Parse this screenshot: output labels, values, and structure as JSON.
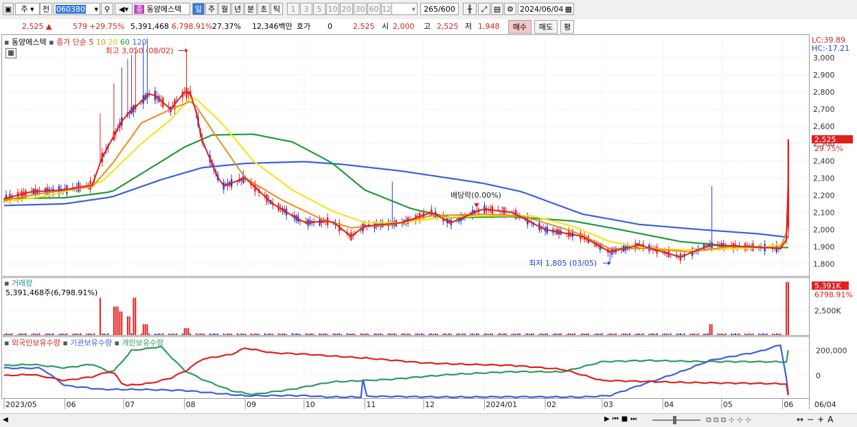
{
  "toolbar": {
    "tab_stock": "주",
    "tab_prev": "전",
    "code": "060380",
    "stock_badge": "종",
    "stock_name": "동양에스텍",
    "periods": [
      "일",
      "주",
      "월",
      "년",
      "분",
      "초",
      "틱"
    ],
    "selected_period": "일",
    "intervals": [
      "1",
      "3",
      "5",
      "10",
      "20",
      "30",
      "60",
      "120"
    ],
    "count": "265",
    "count_total": "/600",
    "date": "2024/06/04"
  },
  "quote": {
    "price": "2,525",
    "change": "579",
    "change_pct": "+29.75%",
    "volume": "5,391,468",
    "volume_pct": "6,798.91%",
    "turnover_pct": "27.37%",
    "amount": "12,346백만",
    "ask_label": "호가",
    "ask_value": "0",
    "ask_price": "2,525",
    "open_label": "시",
    "open": "2,000",
    "high_label": "고",
    "high": "2,525",
    "low_label": "저",
    "low": "1,948",
    "buy_label": "매수",
    "sell_label": "매도",
    "avg_label": "평"
  },
  "colors": {
    "up": "#e0201e",
    "down": "#1f3fd6",
    "ma5": "#e0201e",
    "ma10": "#f08a16",
    "ma20": "#f6e61a",
    "ma60": "#1e9a3a",
    "ma120": "#3a5fe0",
    "foreign": "#e0201e",
    "institution": "#3a5fe0",
    "individual": "#2e9a5e"
  },
  "chart_data": [
    {
      "type": "candlestick",
      "legend_name": "동양에스텍",
      "legend_series": "종가 단순",
      "ma_periods": [
        "5",
        "10",
        "20",
        "60",
        "120"
      ],
      "y_ticks": [
        "3,000",
        "2,900",
        "2,800",
        "2,700",
        "2,600",
        "2,500",
        "2,400",
        "2,300",
        "2,200",
        "2,100",
        "2,000",
        "1,900",
        "1,800"
      ],
      "ylim": [
        1730,
        3120
      ],
      "lc_label": "LC:39.89",
      "hc_label": "HC:-17.21",
      "last_price_label": "2,525",
      "last_change_label": "29.75%",
      "max_annotation": "최고 3,050 (08/02)",
      "min_annotation": "최저 1,805 (03/05)",
      "dividend_annotation": "배당락(0.00%)",
      "ma5_key": [
        [
          "2023-05-01",
          2180
        ],
        [
          "2023-05-15",
          2220
        ],
        [
          "2023-05-31",
          2230
        ],
        [
          "2023-06-15",
          2260
        ],
        [
          "2023-06-20",
          2420
        ],
        [
          "2023-07-01",
          2650
        ],
        [
          "2023-07-15",
          2800
        ],
        [
          "2023-07-25",
          2700
        ],
        [
          "2023-08-01",
          2800
        ],
        [
          "2023-08-05",
          2790
        ],
        [
          "2023-08-10",
          2520
        ],
        [
          "2023-08-20",
          2250
        ],
        [
          "2023-09-01",
          2300
        ],
        [
          "2023-09-15",
          2150
        ],
        [
          "2023-10-01",
          2040
        ],
        [
          "2023-10-15",
          2050
        ],
        [
          "2023-10-25",
          1960
        ],
        [
          "2023-11-01",
          2020
        ],
        [
          "2023-11-20",
          2040
        ],
        [
          "2023-12-05",
          2100
        ],
        [
          "2023-12-15",
          2040
        ],
        [
          "2023-12-31",
          2120
        ],
        [
          "2024-01-15",
          2100
        ],
        [
          "2024-02-01",
          2000
        ],
        [
          "2024-02-20",
          1960
        ],
        [
          "2024-03-05",
          1870
        ],
        [
          "2024-03-20",
          1910
        ],
        [
          "2024-04-10",
          1840
        ],
        [
          "2024-04-25",
          1910
        ],
        [
          "2024-05-15",
          1900
        ],
        [
          "2024-05-31",
          1890
        ],
        [
          "2024-06-03",
          1940
        ],
        [
          "2024-06-04",
          2300
        ]
      ],
      "ma10_key": [
        [
          "2023-05-01",
          2170
        ],
        [
          "2023-05-20",
          2210
        ],
        [
          "2023-06-15",
          2250
        ],
        [
          "2023-06-25",
          2380
        ],
        [
          "2023-07-10",
          2620
        ],
        [
          "2023-07-25",
          2700
        ],
        [
          "2023-08-05",
          2750
        ],
        [
          "2023-08-15",
          2580
        ],
        [
          "2023-09-01",
          2300
        ],
        [
          "2023-09-20",
          2170
        ],
        [
          "2023-10-10",
          2060
        ],
        [
          "2023-10-25",
          2010
        ],
        [
          "2023-11-15",
          2030
        ],
        [
          "2023-12-05",
          2080
        ],
        [
          "2023-12-31",
          2090
        ],
        [
          "2024-01-20",
          2080
        ],
        [
          "2024-02-15",
          1990
        ],
        [
          "2024-03-05",
          1890
        ],
        [
          "2024-03-25",
          1890
        ],
        [
          "2024-04-15",
          1870
        ],
        [
          "2024-05-05",
          1900
        ],
        [
          "2024-05-31",
          1895
        ],
        [
          "2024-06-04",
          2010
        ]
      ],
      "ma20_key": [
        [
          "2023-05-01",
          2160
        ],
        [
          "2023-05-25",
          2200
        ],
        [
          "2023-06-20",
          2280
        ],
        [
          "2023-07-10",
          2500
        ],
        [
          "2023-07-25",
          2640
        ],
        [
          "2023-08-05",
          2780
        ],
        [
          "2023-08-20",
          2620
        ],
        [
          "2023-09-05",
          2400
        ],
        [
          "2023-09-25",
          2230
        ],
        [
          "2023-10-15",
          2110
        ],
        [
          "2023-11-01",
          2040
        ],
        [
          "2023-11-20",
          2040
        ],
        [
          "2023-12-10",
          2070
        ],
        [
          "2023-12-31",
          2080
        ],
        [
          "2024-01-25",
          2080
        ],
        [
          "2024-02-15",
          2020
        ],
        [
          "2024-03-05",
          1930
        ],
        [
          "2024-03-25",
          1890
        ],
        [
          "2024-04-20",
          1880
        ],
        [
          "2024-05-20",
          1895
        ],
        [
          "2024-06-04",
          1920
        ]
      ],
      "ma60_key": [
        [
          "2023-05-01",
          2180
        ],
        [
          "2023-06-01",
          2185
        ],
        [
          "2023-06-25",
          2220
        ],
        [
          "2023-07-15",
          2360
        ],
        [
          "2023-08-01",
          2480
        ],
        [
          "2023-08-15",
          2550
        ],
        [
          "2023-09-05",
          2555
        ],
        [
          "2023-09-25",
          2510
        ],
        [
          "2023-10-15",
          2390
        ],
        [
          "2023-11-01",
          2230
        ],
        [
          "2023-11-25",
          2120
        ],
        [
          "2023-12-15",
          2070
        ],
        [
          "2024-01-15",
          2075
        ],
        [
          "2024-02-15",
          2050
        ],
        [
          "2024-03-10",
          2000
        ],
        [
          "2024-04-10",
          1930
        ],
        [
          "2024-05-10",
          1900
        ],
        [
          "2024-06-04",
          1895
        ]
      ],
      "ma120_key": [
        [
          "2023-05-01",
          2140
        ],
        [
          "2023-06-01",
          2150
        ],
        [
          "2023-06-25",
          2190
        ],
        [
          "2023-07-20",
          2290
        ],
        [
          "2023-08-10",
          2360
        ],
        [
          "2023-09-01",
          2385
        ],
        [
          "2023-10-01",
          2395
        ],
        [
          "2023-10-20",
          2380
        ],
        [
          "2023-11-20",
          2340
        ],
        [
          "2023-12-31",
          2270
        ],
        [
          "2024-01-20",
          2220
        ],
        [
          "2024-02-20",
          2090
        ],
        [
          "2024-03-20",
          2030
        ],
        [
          "2024-04-20",
          2000
        ],
        [
          "2024-05-20",
          1975
        ],
        [
          "2024-06-04",
          1955
        ]
      ]
    },
    {
      "type": "bar",
      "title": "거래량",
      "value_label": "5,391,468주(6,798.91%)",
      "y_ticks": [
        "2,500K"
      ],
      "ylim": [
        0,
        5600000
      ],
      "last_volume_label": "5,391K",
      "last_pct_label": "6798.91%",
      "spikes": [
        [
          "2023-06-18",
          3800000
        ],
        [
          "2023-06-27",
          2900000
        ],
        [
          "2023-06-30",
          2400000
        ],
        [
          "2023-07-03",
          1900000
        ],
        [
          "2023-07-07",
          3800000
        ],
        [
          "2023-07-12",
          1100000
        ],
        [
          "2023-08-02",
          700000
        ],
        [
          "2024-04-26",
          1100000
        ],
        [
          "2024-06-04",
          5391468
        ]
      ],
      "baseline": 120000
    },
    {
      "type": "line",
      "series_names": [
        "외국인보유수량",
        "기관보유수량",
        "개인보유수량"
      ],
      "y_ticks": [
        "200,000",
        "0"
      ],
      "ylim": [
        -180000,
        290000
      ],
      "foreign_key": [
        [
          "2023-05-01",
          0
        ],
        [
          "2023-05-15",
          10000
        ],
        [
          "2023-06-01",
          -40000
        ],
        [
          "2023-06-15",
          -10000
        ],
        [
          "2023-06-25",
          40000
        ],
        [
          "2023-07-01",
          -80000
        ],
        [
          "2023-07-15",
          -60000
        ],
        [
          "2023-07-25",
          -20000
        ],
        [
          "2023-08-02",
          40000
        ],
        [
          "2023-08-10",
          130000
        ],
        [
          "2023-08-25",
          170000
        ],
        [
          "2023-09-01",
          220000
        ],
        [
          "2023-09-15",
          180000
        ],
        [
          "2023-10-01",
          170000
        ],
        [
          "2023-11-01",
          140000
        ],
        [
          "2023-12-01",
          100000
        ],
        [
          "2024-01-15",
          80000
        ],
        [
          "2024-02-10",
          50000
        ],
        [
          "2024-03-01",
          -40000
        ],
        [
          "2024-04-01",
          -50000
        ],
        [
          "2024-05-01",
          -60000
        ],
        [
          "2024-06-03",
          -65000
        ],
        [
          "2024-06-04",
          -160000
        ]
      ],
      "institution_key": [
        [
          "2023-05-01",
          60000
        ],
        [
          "2023-05-20",
          60000
        ],
        [
          "2023-06-01",
          -80000
        ],
        [
          "2023-06-20",
          -110000
        ],
        [
          "2023-07-10",
          -110000
        ],
        [
          "2023-08-01",
          -120000
        ],
        [
          "2023-09-01",
          -160000
        ],
        [
          "2023-10-01",
          -160000
        ],
        [
          "2023-10-12",
          -170000
        ],
        [
          "2023-10-30",
          -170000
        ],
        [
          "2023-10-31",
          -30000
        ],
        [
          "2023-11-02",
          -165000
        ],
        [
          "2023-12-01",
          -170000
        ],
        [
          "2024-01-15",
          -170000
        ],
        [
          "2024-02-20",
          -170000
        ],
        [
          "2024-03-05",
          -160000
        ],
        [
          "2024-03-20",
          -80000
        ],
        [
          "2024-04-10",
          30000
        ],
        [
          "2024-04-25",
          120000
        ],
        [
          "2024-05-20",
          190000
        ],
        [
          "2024-06-01",
          250000
        ],
        [
          "2024-06-04",
          -150000
        ]
      ],
      "individual_key": [
        [
          "2023-05-01",
          80000
        ],
        [
          "2023-05-15",
          90000
        ],
        [
          "2023-06-01",
          60000
        ],
        [
          "2023-06-15",
          90000
        ],
        [
          "2023-06-25",
          20000
        ],
        [
          "2023-07-05",
          200000
        ],
        [
          "2023-07-20",
          230000
        ],
        [
          "2023-08-01",
          40000
        ],
        [
          "2023-08-10",
          -30000
        ],
        [
          "2023-08-25",
          -120000
        ],
        [
          "2023-09-05",
          -150000
        ],
        [
          "2023-09-25",
          -110000
        ],
        [
          "2023-10-15",
          -50000
        ],
        [
          "2023-11-15",
          -30000
        ],
        [
          "2023-12-15",
          10000
        ],
        [
          "2024-01-15",
          30000
        ],
        [
          "2024-02-10",
          30000
        ],
        [
          "2024-03-01",
          110000
        ],
        [
          "2024-03-25",
          120000
        ],
        [
          "2024-05-01",
          110000
        ],
        [
          "2024-06-03",
          110000
        ],
        [
          "2024-06-04",
          200000
        ]
      ]
    }
  ],
  "xaxis": {
    "labels": [
      [
        "2023-05-01",
        "2023/05"
      ],
      [
        "2023-06-01",
        "06"
      ],
      [
        "2023-07-01",
        "07"
      ],
      [
        "2023-08-01",
        "08"
      ],
      [
        "2023-09-01",
        "09"
      ],
      [
        "2023-10-01",
        "10"
      ],
      [
        "2023-11-01",
        "11"
      ],
      [
        "2023-12-01",
        "12"
      ],
      [
        "2024-01-01",
        "2024/01"
      ],
      [
        "2024-02-01",
        "02"
      ],
      [
        "2024-03-01",
        "03"
      ],
      [
        "2024-04-01",
        "04"
      ],
      [
        "2024-05-01",
        "05"
      ],
      [
        "2024-06-01",
        "06"
      ]
    ],
    "right_label": "06/04"
  }
}
